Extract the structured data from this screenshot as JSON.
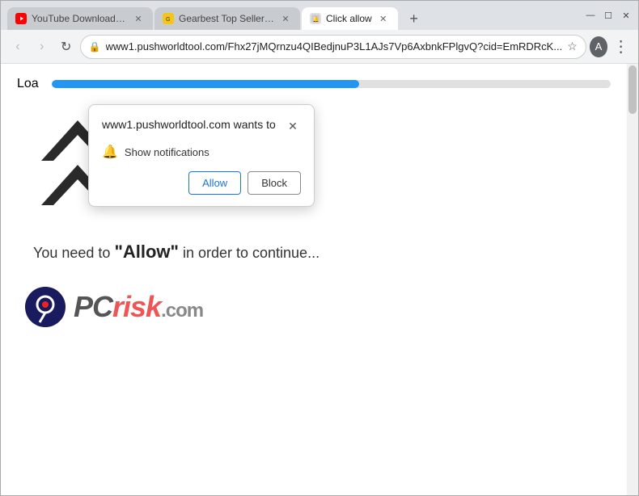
{
  "browser": {
    "title_bar": {
      "tabs": [
        {
          "id": "tab1",
          "title": "YouTube Downloader - D...",
          "favicon_type": "yt",
          "active": false
        },
        {
          "id": "tab2",
          "title": "Gearbest Top Seller - Dive...",
          "favicon_type": "gb",
          "active": false
        },
        {
          "id": "tab3",
          "title": "Click allow",
          "favicon_type": "click",
          "active": true
        }
      ],
      "new_tab_label": "+",
      "window_controls": {
        "minimize": "—",
        "maximize": "☐",
        "close": "✕"
      }
    },
    "nav_bar": {
      "back_label": "‹",
      "forward_label": "›",
      "refresh_label": "↻",
      "address": "www1.pushworldtool.com/Fhx27jMQrnzu4QIBedjnuP3L1AJs7Vp6AxbnkFPlgvQ?cid=EmRDRcK...",
      "star_label": "☆",
      "profile_label": "A",
      "more_label": "⋮"
    }
  },
  "permission_dialog": {
    "title": "www1.pushworldtool.com wants to",
    "close_label": "✕",
    "permission_text": "Show notifications",
    "allow_label": "Allow",
    "block_label": "Block"
  },
  "page": {
    "loading_label": "Loa",
    "progress_percent": 55,
    "arrow_color": "#2a2a2a",
    "allow_text_prefix": "You need to ",
    "allow_text_main": "\"Allow\"",
    "allow_text_suffix": " in order to continue...",
    "logo": {
      "pc_text": "PC",
      "risk_text": "risk",
      "com_text": ".com"
    }
  },
  "colors": {
    "accent": "#1a73e8",
    "progress_fill": "#2196F3",
    "tab_active_bg": "#ffffff",
    "tab_inactive_bg": "#c8ccd1"
  }
}
